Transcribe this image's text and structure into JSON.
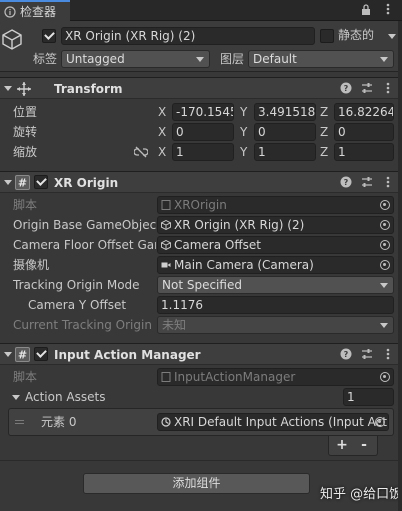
{
  "tab": {
    "label": "检查器",
    "lock_icon": "lock-icon",
    "menu_icon": "kebab-menu-icon"
  },
  "header": {
    "name": "XR Origin (XR Rig) (2)",
    "static_label": "静态的",
    "tag_label": "标签",
    "tag_value": "Untagged",
    "layer_label": "图层",
    "layer_value": "Default"
  },
  "transform": {
    "title": "Transform",
    "rows": [
      {
        "label": "位置",
        "x": "-170.1545",
        "y": "3.491518",
        "z": "16.82264"
      },
      {
        "label": "旋转",
        "x": "0",
        "y": "0",
        "z": "0"
      },
      {
        "label": "缩放",
        "x": "1",
        "y": "1",
        "z": "1"
      }
    ],
    "axis": {
      "x": "X",
      "y": "Y",
      "z": "Z"
    }
  },
  "xr_origin": {
    "title": "XR Origin",
    "script_label": "脚本",
    "script_value": "XROrigin",
    "base_go_label": "Origin Base GameObject",
    "base_go_value": "XR Origin (XR Rig) (2)",
    "floor_offset_label": "Camera Floor Offset GameObject",
    "floor_offset_value": "Camera Offset",
    "camera_label": "摄像机",
    "camera_value": "Main Camera (Camera)",
    "tracking_mode_label": "Tracking Origin Mode",
    "tracking_mode_value": "Not Specified",
    "cam_y_label": "Camera Y Offset",
    "cam_y_value": "1.1176",
    "current_mode_label": "Current Tracking Origin",
    "current_mode_value": "未知"
  },
  "input_action_manager": {
    "title": "Input Action Manager",
    "script_label": "脚本",
    "script_value": "InputActionManager",
    "assets_label": "Action Assets",
    "assets_count": "1",
    "element_label": "元素 0",
    "element_value": "XRI Default Input Actions (Input Actions)",
    "plus": "+",
    "minus": "-"
  },
  "add_component": "添加组件",
  "watermark": "知乎 @给口饭吃",
  "colors": {
    "accent": "#4a8adf",
    "bg": "#383838",
    "header": "#3e3e3e",
    "field": "#2a2a2a"
  }
}
